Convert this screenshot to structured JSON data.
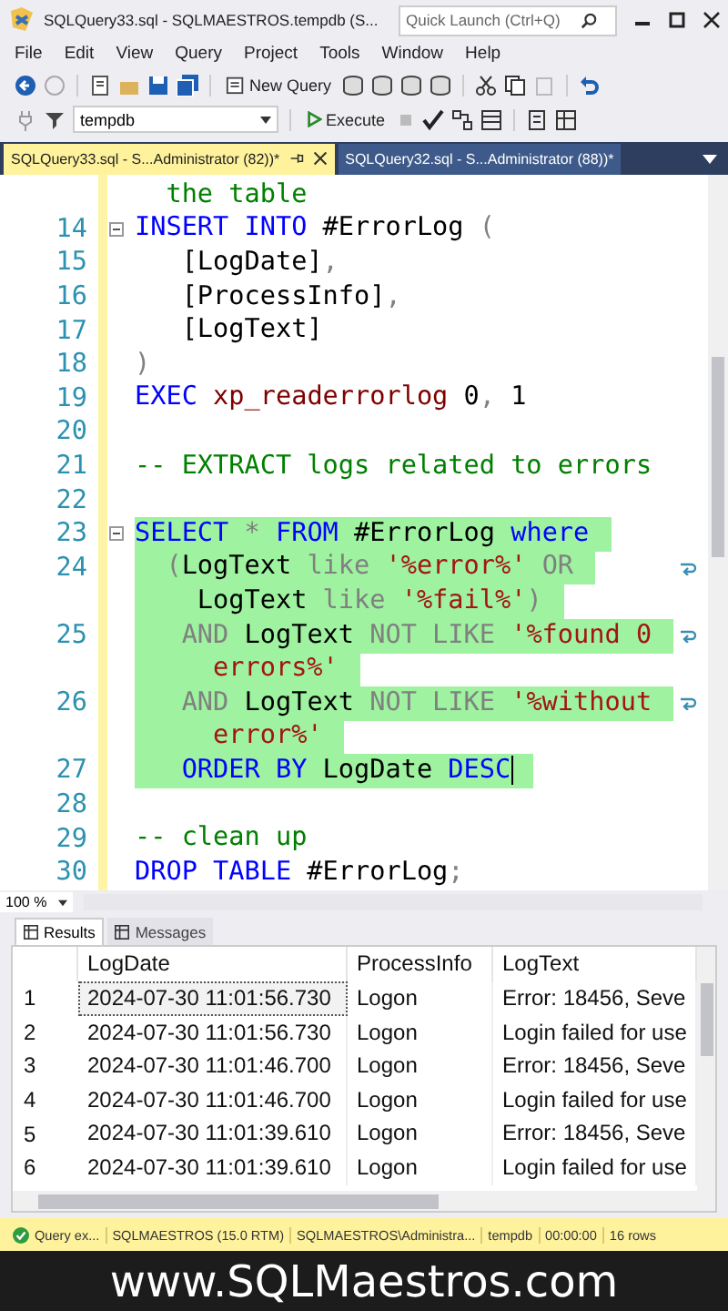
{
  "window": {
    "title": "SQLQuery33.sql - SQLMAESTROS.tempdb (S..."
  },
  "quick_launch": {
    "placeholder": "Quick Launch (Ctrl+Q)"
  },
  "menu": [
    "File",
    "Edit",
    "View",
    "Query",
    "Project",
    "Tools",
    "Window",
    "Help"
  ],
  "toolbar": {
    "new_query": "New Query",
    "database": "tempdb",
    "execute": "Execute"
  },
  "tabs": [
    {
      "label": "SQLQuery33.sql - S...Administrator (82))*",
      "selected": true
    },
    {
      "label": "SQLQuery32.sql - S...Administrator (88))*",
      "selected": false
    }
  ],
  "editor": {
    "rows": [
      {
        "selected": false,
        "fold": false,
        "wrap": false,
        "cursor": false,
        "tokens": [
          {
            "t": "  the table",
            "kind": "cm"
          }
        ]
      },
      {
        "number": "14",
        "selected": false,
        "fold": true,
        "wrap": false,
        "cursor": false,
        "tokens": [
          {
            "t": "INSERT INTO",
            "kind": "kw"
          },
          {
            "t": " #ErrorLog ",
            "kind": "id"
          },
          {
            "t": "(",
            "kind": "op"
          }
        ]
      },
      {
        "number": "15",
        "selected": false,
        "fold": false,
        "wrap": false,
        "cursor": false,
        "tokens": [
          {
            "t": "   [LogDate]",
            "kind": "id"
          },
          {
            "t": ",",
            "kind": "op"
          }
        ]
      },
      {
        "number": "16",
        "selected": false,
        "fold": false,
        "wrap": false,
        "cursor": false,
        "tokens": [
          {
            "t": "   [ProcessInfo]",
            "kind": "id"
          },
          {
            "t": ",",
            "kind": "op"
          }
        ]
      },
      {
        "number": "17",
        "selected": false,
        "fold": false,
        "wrap": false,
        "cursor": false,
        "tokens": [
          {
            "t": "   [LogText]",
            "kind": "id"
          }
        ]
      },
      {
        "number": "18",
        "selected": false,
        "fold": false,
        "wrap": false,
        "cursor": false,
        "tokens": [
          {
            "t": ")",
            "kind": "op"
          }
        ]
      },
      {
        "number": "19",
        "selected": false,
        "fold": false,
        "wrap": false,
        "cursor": false,
        "tokens": [
          {
            "t": "EXEC ",
            "kind": "kw"
          },
          {
            "t": "xp_readerrorlog",
            "kind": "fn"
          },
          {
            "t": " 0",
            "kind": "id"
          },
          {
            "t": ",",
            "kind": "op"
          },
          {
            "t": " 1",
            "kind": "id"
          }
        ]
      },
      {
        "number": "20",
        "selected": false,
        "fold": false,
        "wrap": false,
        "cursor": false,
        "tokens": []
      },
      {
        "number": "21",
        "selected": false,
        "fold": false,
        "wrap": false,
        "cursor": false,
        "tokens": [
          {
            "t": "-- EXTRACT logs related to errors",
            "kind": "cm"
          }
        ]
      },
      {
        "number": "22",
        "selected": false,
        "fold": false,
        "wrap": false,
        "cursor": false,
        "tokens": []
      },
      {
        "number": "23",
        "selected": true,
        "fold": true,
        "wrap": false,
        "cursor": false,
        "tokens": [
          {
            "t": "SELECT ",
            "kind": "kw"
          },
          {
            "t": "* ",
            "kind": "op"
          },
          {
            "t": "FROM",
            "kind": "kw"
          },
          {
            "t": " #ErrorLog ",
            "kind": "id"
          },
          {
            "t": "where",
            "kind": "kw"
          }
        ]
      },
      {
        "number": "24",
        "selected": true,
        "fold": false,
        "wrap": true,
        "cursor": false,
        "tokens": [
          {
            "t": "  (",
            "kind": "op"
          },
          {
            "t": "LogText ",
            "kind": "id"
          },
          {
            "t": "like ",
            "kind": "op"
          },
          {
            "t": "'%error%'",
            "kind": "str"
          },
          {
            "t": " OR",
            "kind": "op"
          }
        ]
      },
      {
        "selected": true,
        "fold": false,
        "wrap": false,
        "cursor": false,
        "tokens": [
          {
            "t": "    LogText ",
            "kind": "id"
          },
          {
            "t": "like ",
            "kind": "op"
          },
          {
            "t": "'%fail%'",
            "kind": "str"
          },
          {
            "t": ")",
            "kind": "op"
          }
        ]
      },
      {
        "number": "25",
        "selected": true,
        "fold": false,
        "wrap": true,
        "cursor": false,
        "tokens": [
          {
            "t": "   AND",
            "kind": "op"
          },
          {
            "t": " LogText ",
            "kind": "id"
          },
          {
            "t": "NOT LIKE ",
            "kind": "op"
          },
          {
            "t": "'%found 0",
            "kind": "str"
          }
        ]
      },
      {
        "selected": true,
        "fold": false,
        "wrap": false,
        "cursor": false,
        "tokens": [
          {
            "t": "     errors%'",
            "kind": "str"
          }
        ]
      },
      {
        "number": "26",
        "selected": true,
        "fold": false,
        "wrap": true,
        "cursor": false,
        "tokens": [
          {
            "t": "   AND",
            "kind": "op"
          },
          {
            "t": " LogText ",
            "kind": "id"
          },
          {
            "t": "NOT LIKE ",
            "kind": "op"
          },
          {
            "t": "'%without",
            "kind": "str"
          }
        ]
      },
      {
        "selected": true,
        "fold": false,
        "wrap": false,
        "cursor": false,
        "tokens": [
          {
            "t": "     error%'",
            "kind": "str"
          }
        ]
      },
      {
        "number": "27",
        "selected": true,
        "fold": false,
        "wrap": false,
        "cursor": true,
        "tokens": [
          {
            "t": "   ORDER BY",
            "kind": "kw"
          },
          {
            "t": " LogDate ",
            "kind": "id"
          },
          {
            "t": "DESC",
            "kind": "kw"
          }
        ]
      },
      {
        "number": "28",
        "selected": false,
        "fold": false,
        "wrap": false,
        "cursor": false,
        "tokens": []
      },
      {
        "number": "29",
        "selected": false,
        "fold": false,
        "wrap": false,
        "cursor": false,
        "tokens": [
          {
            "t": "-- clean up",
            "kind": "cm"
          }
        ]
      },
      {
        "number": "30",
        "selected": false,
        "fold": false,
        "wrap": false,
        "cursor": false,
        "tokens": [
          {
            "t": "DROP TABLE",
            "kind": "kw"
          },
          {
            "t": " #ErrorLog",
            "kind": "id"
          },
          {
            "t": ";",
            "kind": "op"
          }
        ]
      }
    ]
  },
  "zoom": "100 %",
  "result_tabs": [
    {
      "label": "Results",
      "selected": true
    },
    {
      "label": "Messages",
      "selected": false
    }
  ],
  "grid": {
    "columns": [
      "LogDate",
      "ProcessInfo",
      "LogText"
    ],
    "rows": [
      {
        "number": "1",
        "focused": true,
        "cells": [
          "2024-07-30 11:01:56.730",
          "Logon",
          "Error: 18456, Seve"
        ]
      },
      {
        "number": "2",
        "focused": false,
        "cells": [
          "2024-07-30 11:01:56.730",
          "Logon",
          "Login failed for use"
        ]
      },
      {
        "number": "3",
        "focused": false,
        "cells": [
          "2024-07-30 11:01:46.700",
          "Logon",
          "Error: 18456, Seve"
        ]
      },
      {
        "number": "4",
        "focused": false,
        "cells": [
          "2024-07-30 11:01:46.700",
          "Logon",
          "Login failed for use"
        ]
      },
      {
        "number": "5",
        "focused": false,
        "cells": [
          "2024-07-30 11:01:39.610",
          "Logon",
          "Error: 18456, Seve"
        ]
      },
      {
        "number": "6",
        "focused": false,
        "cells": [
          "2024-07-30 11:01:39.610",
          "Logon",
          "Login failed for use"
        ]
      }
    ]
  },
  "status_bar": {
    "items": [
      {
        "text": "Query ex...",
        "kind": "success"
      },
      {
        "text": "SQLMAESTROS (15.0 RTM)",
        "kind": "plain"
      },
      {
        "text": "SQLMAESTROS\\Administra...",
        "kind": "plain"
      },
      {
        "text": "tempdb",
        "kind": "plain"
      },
      {
        "text": "00:00:00",
        "kind": "plain"
      },
      {
        "text": "16 rows",
        "kind": "plain"
      }
    ]
  },
  "banner": "www.SQLMaestros.com"
}
